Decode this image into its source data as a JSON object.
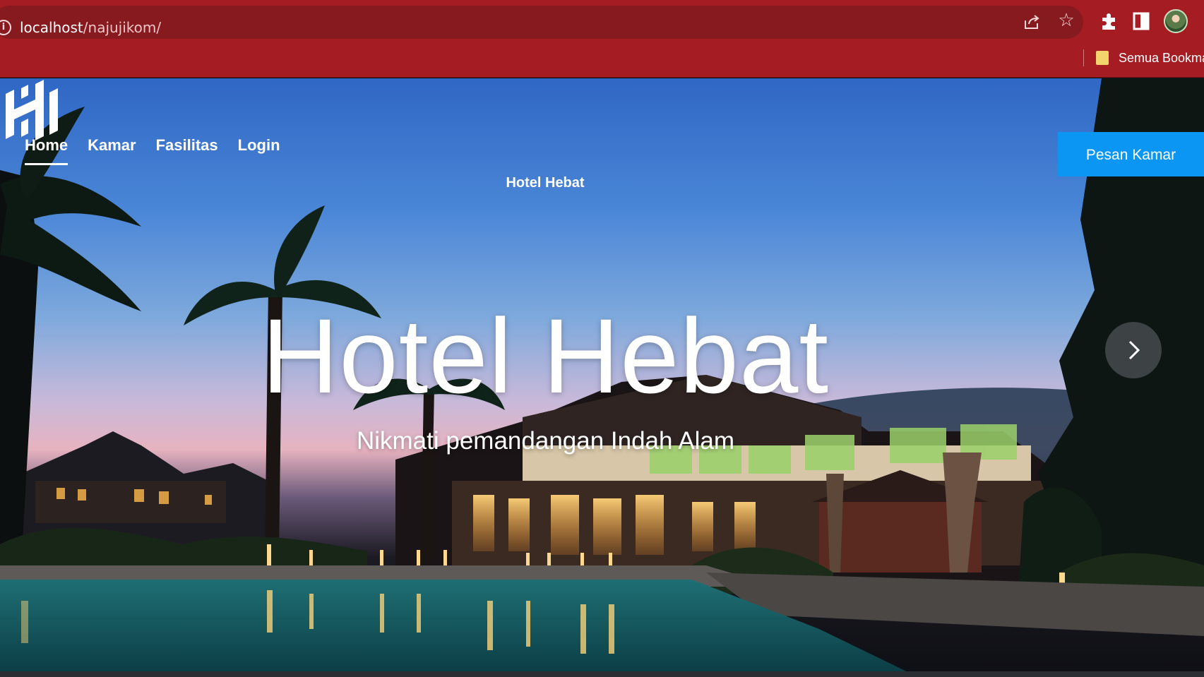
{
  "browser": {
    "url_host": "localhost",
    "url_path": "/najujikom/",
    "bookmarks_label": "Semua Bookma",
    "icons": [
      "info-icon",
      "share-icon",
      "star-icon",
      "extensions-icon",
      "side-panel-icon",
      "profile-avatar",
      "bookmark-folder-icon"
    ]
  },
  "nav": {
    "items": [
      {
        "label": "Home",
        "active": true
      },
      {
        "label": "Kamar",
        "active": false
      },
      {
        "label": "Fasilitas",
        "active": false
      },
      {
        "label": "Login",
        "active": false
      }
    ]
  },
  "logo": {
    "text": "Hotel Hebat"
  },
  "cta": {
    "label": "Pesan Kamar"
  },
  "hero": {
    "title": "Hotel Hebat",
    "subtitle": "Nikmati pemandangan Indah Alam",
    "next_icon": "chevron-right-icon"
  },
  "colors": {
    "browser_bar": "#a51d22",
    "cta": "#0a96f2",
    "text": "#ffffff"
  }
}
